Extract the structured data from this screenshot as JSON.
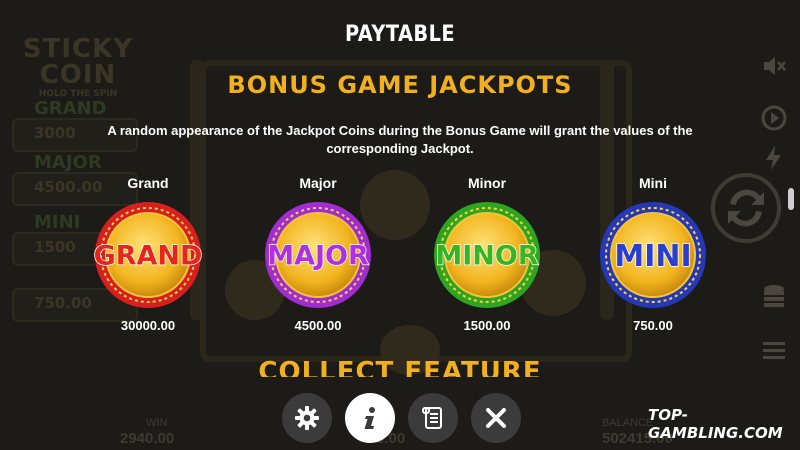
{
  "paytable": {
    "title": "PAYTABLE",
    "section_title": "BONUS GAME JACKPOTS",
    "description": "A random appearance of the Jackpot Coins during the Bonus Game will grant the values of the corresponding Jackpot.",
    "jackpots": [
      {
        "name": "Grand",
        "coin_label": "GRAND",
        "value": "30000.00",
        "rim_color": "#d81f1f",
        "text_color": "#e8251b"
      },
      {
        "name": "Major",
        "coin_label": "MAJOR",
        "value": "4500.00",
        "rim_color": "#a12ccf",
        "text_color": "#b02fe0"
      },
      {
        "name": "Minor",
        "coin_label": "MINOR",
        "value": "1500.00",
        "rim_color": "#2ea51f",
        "text_color": "#37b51f"
      },
      {
        "name": "Mini",
        "coin_label": "MINI",
        "value": "750.00",
        "rim_color": "#2438b8",
        "text_color": "#2a3fd0"
      }
    ],
    "next_section_title": "COLLECT FEATURE"
  },
  "background": {
    "logo_line1": "STICKY",
    "logo_line2": "COIN",
    "logo_sub": "HOLD THE SPIN",
    "jackpot_panels": [
      {
        "label": "GRAND",
        "value": "3000"
      },
      {
        "label": "MAJOR",
        "value": "4500.00"
      },
      {
        "label": "MINI",
        "value": "1500"
      },
      {
        "label": "",
        "value": "750.00"
      }
    ],
    "win_label": "WIN",
    "win_value": "2940.00",
    "bet_value": "0.00",
    "balance_label": "BALANCE",
    "balance_value": "502415.00"
  },
  "toolbar": {
    "buttons": [
      {
        "name": "settings",
        "icon": "gear-icon"
      },
      {
        "name": "info",
        "icon": "info-icon",
        "active": true
      },
      {
        "name": "paytable",
        "icon": "scroll-icon"
      },
      {
        "name": "close",
        "icon": "close-icon"
      }
    ]
  },
  "watermark": "TOP-GAMBLING.COM",
  "colors": {
    "accent_gold": "#f2b01e",
    "button_dark": "#3b3b3b",
    "button_active": "#ffffff"
  }
}
